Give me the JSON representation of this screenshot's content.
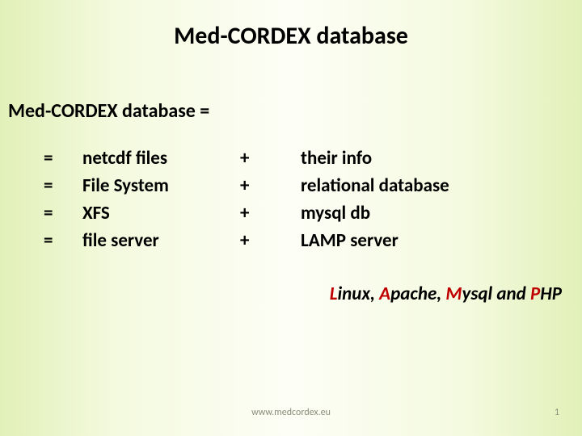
{
  "title": "Med-CORDEX database",
  "subtitle": "Med-CORDEX database =",
  "rows": [
    {
      "eq": "=",
      "left": "netcdf  files",
      "plus": "+",
      "right": "their info"
    },
    {
      "eq": "=",
      "left": " File System",
      "plus": "+",
      "right": "relational database"
    },
    {
      "eq": "=",
      "left": " XFS",
      "plus": "+",
      "right": "mysql db"
    },
    {
      "eq": "=",
      "left": "file server",
      "plus": "+",
      "right": "LAMP server"
    }
  ],
  "lamp": {
    "l": "L",
    "inux": "inux, ",
    "a": "A",
    "pache": "pache, ",
    "m": "M",
    "ysql": "ysql and ",
    "p": "P",
    "hp": "HP"
  },
  "footer_url": "www.medcordex.eu",
  "page_num": "1"
}
